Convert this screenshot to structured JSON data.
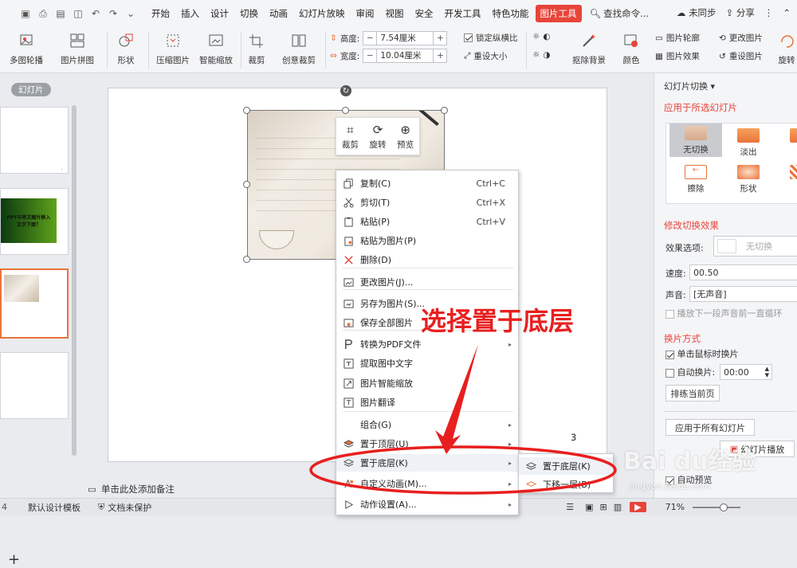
{
  "menu_tabs": [
    "开始",
    "插入",
    "设计",
    "切换",
    "动画",
    "幻灯片放映",
    "审阅",
    "视图",
    "安全",
    "开发工具",
    "特色功能",
    "图片工具"
  ],
  "search_label": "查找命令...",
  "top_right": {
    "sync": "未同步",
    "share": "分享"
  },
  "ribbon": {
    "multi_outline": "多图轮播",
    "collage": "图片拼图",
    "shape": "形状",
    "compress": "压缩图片",
    "smart_scale": "智能缩放",
    "crop": "裁剪",
    "creative_crop": "创意裁剪",
    "height_label": "高度:",
    "height_value": "7.54厘米",
    "width_label": "宽度:",
    "width_value": "10.04厘米",
    "lock_ratio": "锁定纵横比",
    "reset_size": "重设大小",
    "remove_bg": "抠除背景",
    "color": "颜色",
    "outline": "图片轮廓",
    "change_pic": "更改图片",
    "effect": "图片效果",
    "reset_pic": "重设图片",
    "rotate": "旋转"
  },
  "left_panel": {
    "label": "幻灯片",
    "thumb2_text": "PPT中将文图片移入文字下面？"
  },
  "pic_toolbar": {
    "crop": "裁剪",
    "rotate": "旋转",
    "preview": "预览"
  },
  "context_menu": [
    {
      "label": "复制(C)",
      "shortcut": "Ctrl+C",
      "icon": "copy-icon"
    },
    {
      "label": "剪切(T)",
      "shortcut": "Ctrl+X",
      "icon": "cut-icon"
    },
    {
      "label": "粘贴(P)",
      "shortcut": "Ctrl+V",
      "icon": "paste-icon"
    },
    {
      "label": "粘贴为图片(P)",
      "shortcut": "",
      "icon": "paste-image-icon"
    },
    {
      "label": "删除(D)",
      "shortcut": "",
      "icon": "delete-icon"
    },
    {
      "label": "更改图片(J)...",
      "shortcut": "",
      "icon": "change-image-icon"
    },
    {
      "label": "另存为图片(S)...",
      "shortcut": "",
      "icon": "save-image-icon"
    },
    {
      "label": "保存全部图片",
      "shortcut": "",
      "icon": "save-all-icon"
    },
    {
      "label": "转换为PDF文件",
      "shortcut": "",
      "icon": "pdf-icon"
    },
    {
      "label": "提取图中文字",
      "shortcut": "",
      "icon": "ocr-icon"
    },
    {
      "label": "图片智能缩放",
      "shortcut": "",
      "icon": "smart-scale-icon"
    },
    {
      "label": "图片翻译",
      "shortcut": "",
      "icon": "translate-icon"
    },
    {
      "label": "组合(G)",
      "shortcut": "",
      "icon": ""
    },
    {
      "label": "置于顶层(U)",
      "shortcut": "",
      "icon": "bring-front-icon"
    },
    {
      "label": "置于底层(K)",
      "shortcut": "",
      "icon": "send-back-icon"
    },
    {
      "label": "自定义动画(M)...",
      "shortcut": "",
      "icon": "animation-icon"
    },
    {
      "label": "动作设置(A)...",
      "shortcut": "",
      "icon": "action-icon"
    }
  ],
  "submenu": [
    {
      "label": "置于底层(K)"
    },
    {
      "label": "下移一层(B)"
    }
  ],
  "annotation": "选择置于底层",
  "annotation_num": "3",
  "notes_placeholder": "单击此处添加备注",
  "status": {
    "template": "默认设计模板",
    "protect": "文档未保护",
    "zoom": "71%"
  },
  "right_panel": {
    "title": "幻灯片切换",
    "apply_selected": "应用于所选幻灯片",
    "effects": [
      "无切换",
      "淡出",
      "切",
      "擦除",
      "形状",
      "溶"
    ],
    "modify": "修改切换效果",
    "effect_option_label": "效果选项:",
    "effect_option_value": "无切换",
    "speed_label": "速度:",
    "speed_value": "00.50",
    "sound_label": "声音:",
    "sound_value": "[无声音]",
    "loop_label": "播放下一段声音前一直循环",
    "switch_mode": "换片方式",
    "on_click": "单击鼠标时换片",
    "auto": "自动换片:",
    "auto_value": "00:00",
    "sort_current": "排练当前页",
    "apply_all": "应用于所有幻灯片",
    "play": "幻灯片播放",
    "autopreview": "自动预览"
  },
  "watermark": {
    "brand": "Bai du经验",
    "url": "jingyan.baidu.com"
  },
  "colors": {
    "accent": "#e8443a",
    "arrow": "#e81f1f"
  }
}
